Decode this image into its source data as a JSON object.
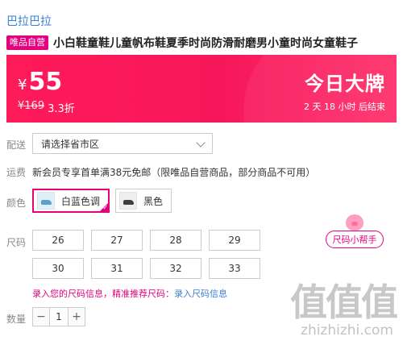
{
  "store": {
    "name": "巴拉巴拉"
  },
  "product": {
    "badge": "唯品自营",
    "title": "小白鞋童鞋儿童帆布鞋夏季时尚防滑耐磨男小童时尚女童鞋子"
  },
  "price": {
    "currency": "¥",
    "current": "55",
    "original": "¥169",
    "discount": "3.3折",
    "promo_title": "今日大牌",
    "countdown": "2 天 18 小时 后结束"
  },
  "delivery": {
    "label": "配送",
    "region_placeholder": "请选择省市区"
  },
  "shipping": {
    "label": "运费",
    "text": "新会员专享首单满38元免邮（限唯品自营商品，部分商品不可用）"
  },
  "color": {
    "label": "颜色",
    "options": [
      {
        "name": "白蓝色调",
        "selected": true
      },
      {
        "name": "黑色",
        "selected": false
      }
    ]
  },
  "size": {
    "label": "尺码",
    "options": [
      "26",
      "27",
      "28",
      "29",
      "30",
      "31",
      "32",
      "33"
    ],
    "helper_label": "尺码小帮手",
    "note": "录入您的尺码信息，精准推荐尺码：",
    "note_link": "录入尺码信息"
  },
  "quantity": {
    "label": "数量",
    "value": "1",
    "minus": "−",
    "plus": "+"
  },
  "watermark": {
    "logo": "值值值",
    "url": "zhizhizhi.com"
  },
  "colors": {
    "accent": "#e4007f",
    "banner": "#ff1b5a",
    "link": "#3a7fd5"
  }
}
